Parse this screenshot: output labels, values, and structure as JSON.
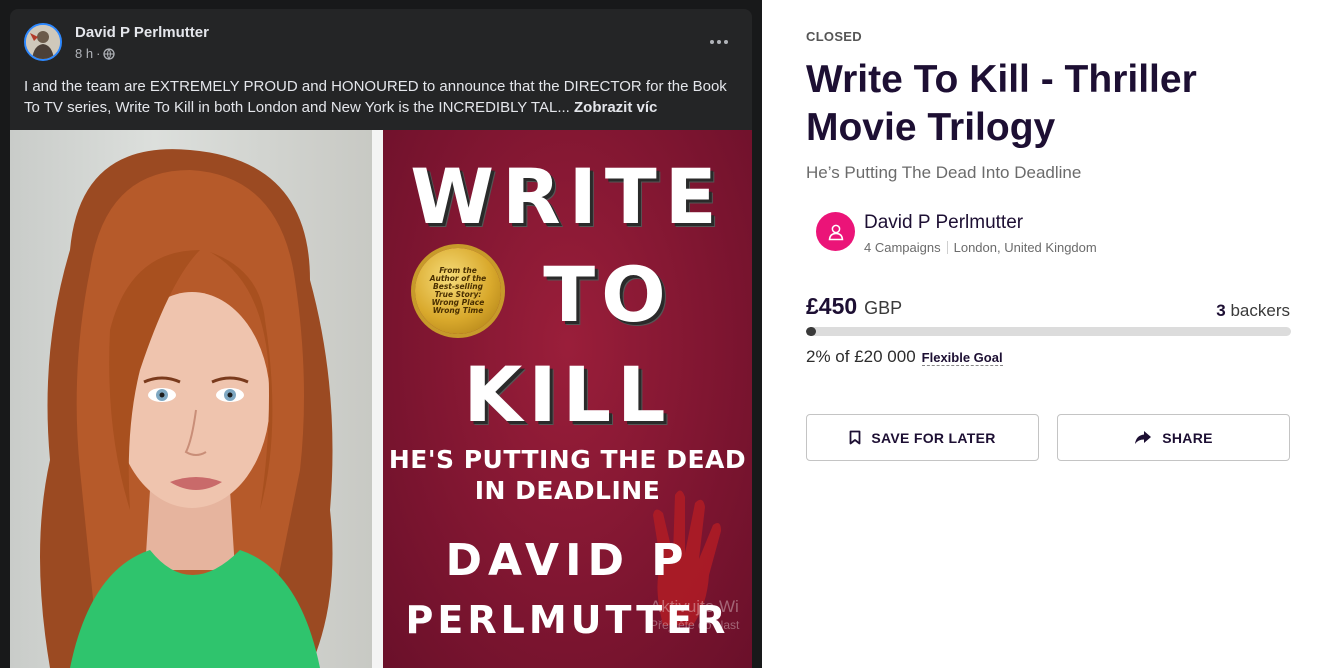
{
  "post": {
    "author": "David P Perlmutter",
    "time": "8 h",
    "text": "I and the team are EXTREMELY PROUD and HONOURED to announce that the DIRECTOR for the Book To TV series, Write To Kill in both London and New York is the INCREDIBLY TAL...",
    "see_more": "Zobrazit víc",
    "cover": {
      "line1": "WRITE",
      "line2": "TO",
      "line3": "KILL",
      "subtitle1": "HE'S PUTTING THE DEAD",
      "subtitle2": "IN DEADLINE",
      "author1": "DAVID P",
      "author2": "PERLMUTTER",
      "seal": "From the Author of the Best-selling True Story: Wrong Place Wrong Time"
    },
    "watermark_line1": "Aktivujte Wi",
    "watermark_line2": "Přejděte do Nast"
  },
  "campaign": {
    "status": "CLOSED",
    "title": "Write To Kill - Thriller Movie Trilogy",
    "tagline": "He’s Putting The Dead Into Deadline",
    "owner": {
      "name": "David P Perlmutter",
      "campaigns": "4 Campaigns",
      "location": "London, United Kingdom"
    },
    "raised_amount": "£450",
    "currency": "GBP",
    "backers_count": "3",
    "backers_label": "backers",
    "progress_fraction": 0.02,
    "goal_text": "2% of £20 000",
    "goal_type": "Flexible Goal",
    "save_label": "SAVE FOR LATER",
    "share_label": "SHARE",
    "accent_color": "#eb1478"
  }
}
